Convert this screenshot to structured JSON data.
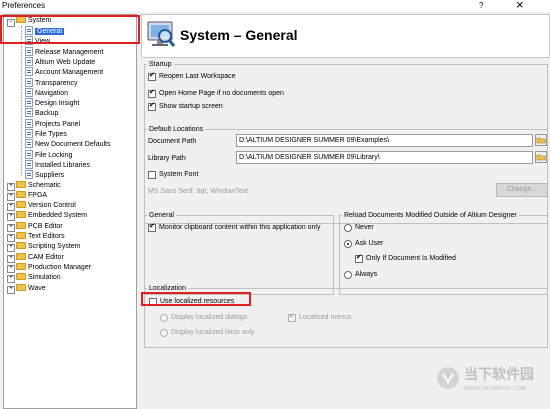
{
  "window": {
    "title": "Preferences",
    "help_label": "?",
    "close_label": "×"
  },
  "tree": {
    "system_label": "System",
    "children": [
      "General",
      "View",
      "Release Management",
      "Altium Web Update",
      "Account Management",
      "Transparency",
      "Navigation",
      "Design Insight",
      "Backup",
      "Projects Panel",
      "File Types",
      "New Document Defaults",
      "File Locking",
      "Installed Libraries",
      "Suppliers"
    ],
    "roots": [
      "Schematic",
      "FPGA",
      "Version Control",
      "Embedded System",
      "PCB Editor",
      "Text Editors",
      "Scripting System",
      "CAM Editor",
      "Production Manager",
      "Simulation",
      "Wave"
    ]
  },
  "header": {
    "title": "System – General"
  },
  "startup": {
    "title": "Startup",
    "reopen_label": "Reopen Last Workspace",
    "homepage_label": "Open Home Page if no documents open",
    "splash_label": "Show startup screen"
  },
  "locations": {
    "title": "Default Locations",
    "document_label": "Document Path",
    "document_value": "D:\\ALTIUM DESIGNER SUMMER 09\\Examples\\",
    "library_label": "Library Path",
    "library_value": "D:\\ALTIUM DESIGNER SUMMER 09\\Library\\"
  },
  "font": {
    "checkbox_label": "System Font",
    "value": "MS Sans Serif, 8pt, WindowText",
    "change_label": "Change..."
  },
  "general": {
    "title": "General",
    "clipboard_label": "Monitor clipboard content within this application only"
  },
  "reload": {
    "title": "Reload Documents Modified Outside of Altium Designer",
    "never_label": "Never",
    "ask_label": "Ask User",
    "only_modified_label": "Only If Document Is Modified",
    "always_label": "Always"
  },
  "localization": {
    "title": "Localization",
    "use_label": "Use localized resources",
    "dialogs_label": "Display localized dialogs",
    "menus_label": "Localized menus",
    "hints_label": "Display localized hints only"
  },
  "colors": {
    "selection": "#2b6cd8",
    "highlight_box": "#e02020"
  },
  "watermark": {
    "text": "当下软件园",
    "sub": "WWW.DOWNXIA.COM"
  }
}
